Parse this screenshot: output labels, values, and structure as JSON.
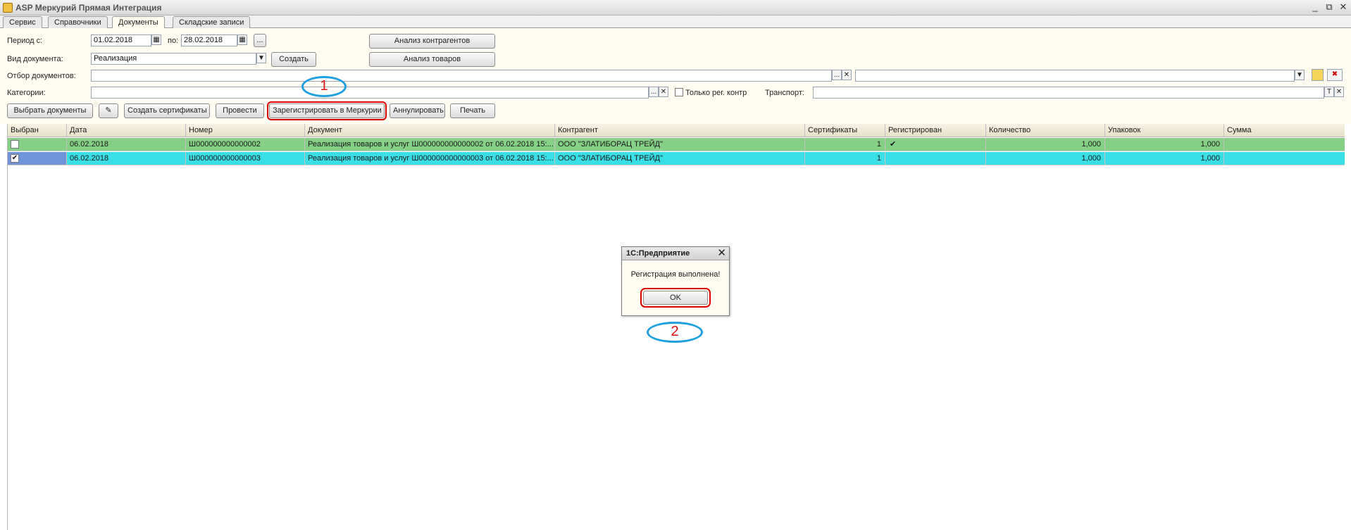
{
  "window": {
    "title": "ASP Меркурий Прямая Интеграция",
    "minimize": "_",
    "restore": "⧉",
    "close": "✕"
  },
  "tabs": [
    {
      "label": "Сервис"
    },
    {
      "label": "Справочники"
    },
    {
      "label": "Документы",
      "active": true
    },
    {
      "label": "Складские записи"
    }
  ],
  "filters": {
    "period_label": "Период с:",
    "date_from": "01.02.2018",
    "to_label": "по:",
    "date_to": "28.02.2018",
    "more_btn": "...",
    "doc_type_label": "Вид документа:",
    "doc_type_value": "Реализация",
    "create_btn": "Создать",
    "analysis_contractors_btn": "Анализ контрагентов",
    "analysis_goods_btn": "Анализ товаров",
    "selection_label": "Отбор документов:",
    "selection_value": "",
    "categories_label": "Категории:",
    "categories_value": "",
    "only_reg_label": "Только рег. контр",
    "transport_label": "Транспорт:",
    "transport_value": "",
    "ellipsis": "...",
    "clear": "✕",
    "T": "T"
  },
  "toolbar": {
    "select_docs": "Выбрать документы",
    "create_certs": "Создать сертификаты",
    "post": "Провести",
    "register_mercury": "Зарегистрировать в Меркурии",
    "cancel": "Аннулировать",
    "print": "Печать"
  },
  "annotations": {
    "one": "1",
    "two": "2"
  },
  "table": {
    "columns": [
      "Выбран",
      "Дата",
      "Номер",
      "Документ",
      "Контрагент",
      "Сертификаты",
      "Регистрирован",
      "Количество",
      "Упаковок",
      "Сумма"
    ],
    "rows": [
      {
        "checked": "",
        "date": "06.02.2018",
        "number": "Ш000000000000002",
        "document": "Реализация товаров и услуг Ш000000000000002 от 06.02.2018 15:...",
        "contractor": "ООО \"ЗЛАТИБОРАЦ ТРЕЙД\"",
        "certs": "1",
        "registered": "✔",
        "qty": "1,000",
        "packs": "1,000",
        "sum": ""
      },
      {
        "checked": "✔",
        "date": "06.02.2018",
        "number": "Ш000000000000003",
        "document": "Реализация товаров и услуг Ш000000000000003 от 06.02.2018 15:...",
        "contractor": "ООО \"ЗЛАТИБОРАЦ ТРЕЙД\"",
        "certs": "1",
        "registered": "",
        "qty": "1,000",
        "packs": "1,000",
        "sum": ""
      }
    ]
  },
  "dialog": {
    "title": "1С:Предприятие",
    "close": "✕",
    "message": "Регистрация выполнена!",
    "ok": "OK"
  },
  "colors": {
    "row_green": "#86cf86",
    "row_cyan": "#39dfe4",
    "highlight_red": "#e00000",
    "annotation_blue": "#1e9fe0"
  }
}
